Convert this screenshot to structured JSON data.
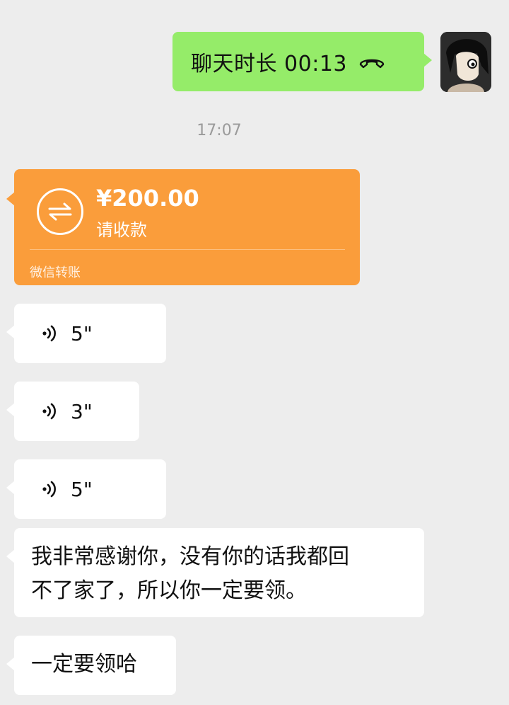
{
  "messages": {
    "call": {
      "label": "聊天时长 00:13",
      "icon": "hangup-icon"
    },
    "timestamp": "17:07",
    "transfer": {
      "amount": "¥200.00",
      "status": "请收款",
      "footer": "微信转账",
      "icon": "transfer-arrows-icon",
      "color": "#fa9d3b"
    },
    "voices": [
      {
        "duration": "5\""
      },
      {
        "duration": "3\""
      },
      {
        "duration": "5\""
      }
    ],
    "texts": [
      {
        "line1": "我非常感谢你，没有你的话我都回",
        "line2": "不了家了，所以你一定要领。"
      },
      {
        "line1": "一定要领哈"
      }
    ]
  },
  "colors": {
    "background": "#ededed",
    "outgoing_bubble": "#95ec69",
    "incoming_bubble": "#ffffff",
    "timestamp": "#9a9a9a"
  }
}
